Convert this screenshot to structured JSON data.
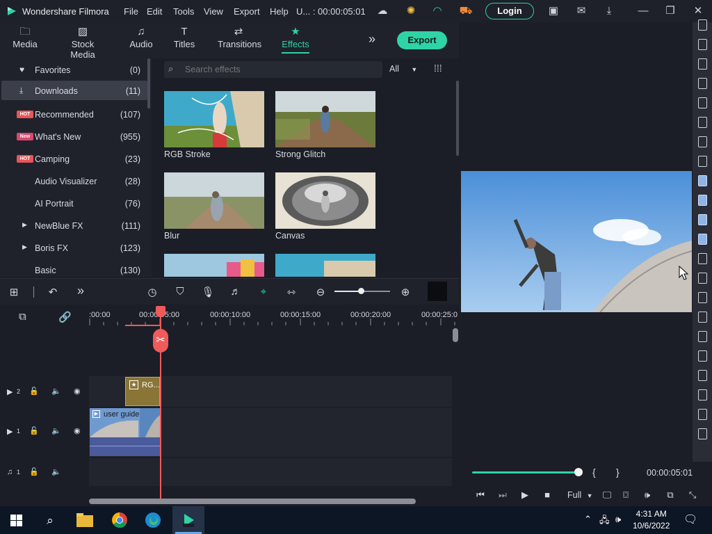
{
  "titlebar": {
    "app_name": "Wondershare Filmora",
    "menus": [
      "File",
      "Edit",
      "Tools",
      "View",
      "Export",
      "Help"
    ],
    "project": "U... : 00:00:05:01",
    "login": "Login"
  },
  "tabs": [
    {
      "label": "Media",
      "icon": "folder-icon"
    },
    {
      "label": "Stock Media",
      "icon": "image-icon"
    },
    {
      "label": "Audio",
      "icon": "music-note-icon"
    },
    {
      "label": "Titles",
      "icon": "text-t-icon"
    },
    {
      "label": "Transitions",
      "icon": "transition-icon"
    },
    {
      "label": "Effects",
      "icon": "effects-star-icon"
    }
  ],
  "export_label": "Export",
  "sidebar": {
    "items": [
      {
        "label": "Favorites",
        "count": "(0)",
        "icon": "heart-icon"
      },
      {
        "label": "Downloads",
        "count": "(11)",
        "icon": "download-icon"
      },
      {
        "label": "Recommended",
        "count": "(107)",
        "badge": "HOT"
      },
      {
        "label": "What's New",
        "count": "(955)",
        "badge": "New"
      },
      {
        "label": "Camping",
        "count": "(23)",
        "badge": "HOT"
      },
      {
        "label": "Audio Visualizer",
        "count": "(28)"
      },
      {
        "label": "AI Portrait",
        "count": "(76)"
      },
      {
        "label": "NewBlue FX",
        "count": "(111)",
        "expandable": true
      },
      {
        "label": "Boris FX",
        "count": "(123)",
        "expandable": true
      },
      {
        "label": "Basic",
        "count": "(130)"
      }
    ]
  },
  "search": {
    "placeholder": "Search effects"
  },
  "filter": {
    "value": "All"
  },
  "effects": [
    {
      "label": "RGB Stroke"
    },
    {
      "label": "Strong Glitch"
    },
    {
      "label": "Blur"
    },
    {
      "label": "Canvas"
    }
  ],
  "timeline": {
    "ticks": [
      ":00:00",
      "00:00:05:00",
      "00:00:10:00",
      "00:00:15:00",
      "00:00:20:00",
      "00:00:25:0"
    ],
    "tracks": [
      {
        "num": "2",
        "type": "video"
      },
      {
        "num": "1",
        "type": "video"
      },
      {
        "num": "1",
        "type": "audio"
      }
    ],
    "effect_clip": "RG...",
    "video_clip": "user guide",
    "zoom_level": 0.48
  },
  "preview": {
    "timecode": "00:00:05:01",
    "quality": "Full",
    "progress": 1.0,
    "mark_in": "{",
    "mark_out": "}"
  },
  "taskbar": {
    "time": "4:31 AM",
    "date": "10/6/2022"
  },
  "colors": {
    "accent": "#2fd3a6",
    "playhead": "#ef5a5a",
    "hot_badge": "#e8555a",
    "new_badge": "#d8486e"
  }
}
